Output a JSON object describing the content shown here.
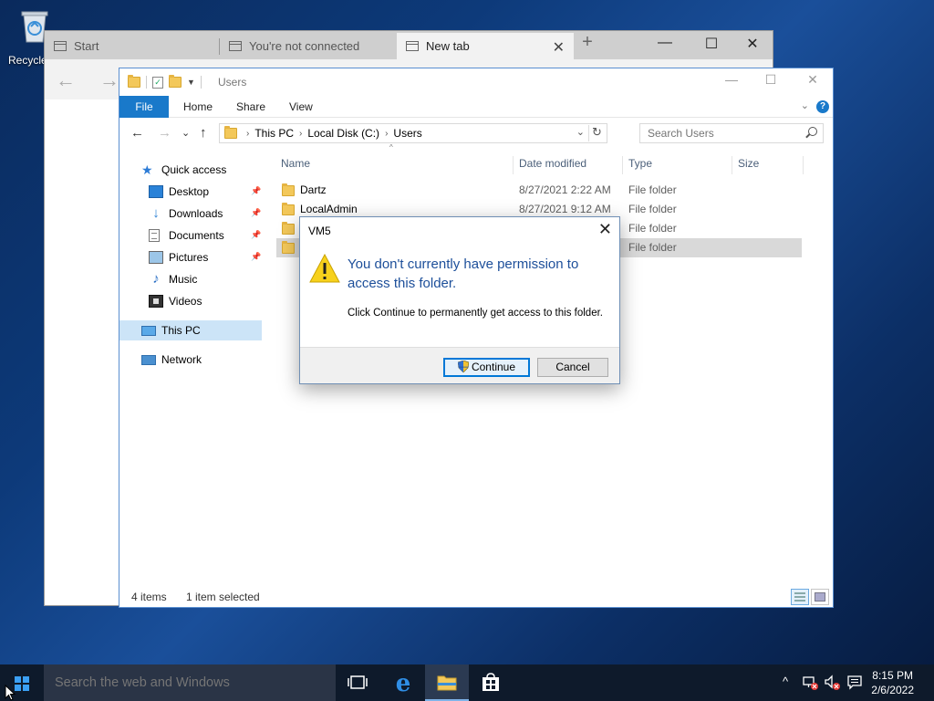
{
  "desktop": {
    "recycle_label": "Recycle"
  },
  "browser": {
    "tabs": [
      {
        "label": "Start"
      },
      {
        "label": "You're not connected"
      },
      {
        "label": "New tab"
      }
    ],
    "new_tab_symbol": "+",
    "close_tab_symbol": "✕",
    "minimize_symbol": "—",
    "maximize_symbol": "☐",
    "close_symbol": "✕",
    "back_symbol": "←",
    "forward_symbol": "→"
  },
  "explorer": {
    "title": "Users",
    "window_controls": {
      "minimize": "—",
      "maximize": "☐",
      "close": "✕"
    },
    "ribbon_tabs": {
      "file": "File",
      "home": "Home",
      "share": "Share",
      "view": "View"
    },
    "ribbon_expand": "⌄",
    "help": "?",
    "nav": {
      "back": "←",
      "forward": "→",
      "recent": "⌄",
      "up": "↑"
    },
    "breadcrumb": [
      "This PC",
      "Local Disk (C:)",
      "Users"
    ],
    "breadcrumb_sep": "›",
    "address_dropdown": "⌄",
    "refresh": "↻",
    "search_placeholder": "Search Users",
    "navpane": {
      "quick_access": "Quick access",
      "desktop": "Desktop",
      "downloads": "Downloads",
      "documents": "Documents",
      "pictures": "Pictures",
      "music": "Music",
      "videos": "Videos",
      "this_pc": "This PC",
      "network": "Network",
      "pin": "📌"
    },
    "columns": {
      "name": "Name",
      "date": "Date modified",
      "type": "Type",
      "size": "Size",
      "sort": "^"
    },
    "files": [
      {
        "name": "Dartz",
        "date": "8/27/2021 2:22 AM",
        "type": "File folder"
      },
      {
        "name": "LocalAdmin",
        "date": "8/27/2021 9:12 AM",
        "type": "File folder"
      },
      {
        "name": "",
        "date": "",
        "type": "File folder"
      },
      {
        "name": "",
        "date": "",
        "type": "File folder"
      }
    ],
    "status": {
      "items": "4 items",
      "selected": "1 item selected"
    }
  },
  "dialog": {
    "title": "VM5",
    "close": "✕",
    "main_text": "You don't currently have permission to access this folder.",
    "sub_text": "Click Continue to permanently get access to this folder.",
    "continue_label": "Continue",
    "cancel_label": "Cancel",
    "warning_symbol": "!"
  },
  "taskbar": {
    "search_placeholder": "Search the web and Windows",
    "tray_up": "^",
    "time": "8:15 PM",
    "date": "2/6/2022"
  },
  "colors": {
    "accent": "#1979ca",
    "dialog_heading": "#1d4f9a",
    "folder": "#f3c85a",
    "taskbar": "#0e1a2b"
  }
}
